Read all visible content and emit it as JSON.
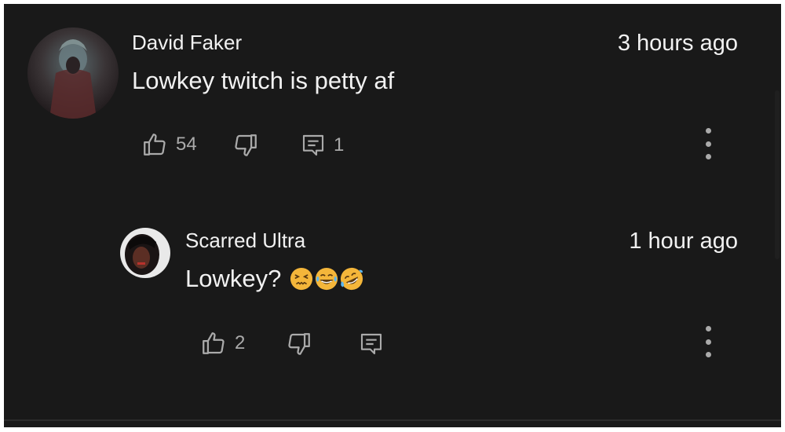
{
  "comments": [
    {
      "author": "David Faker",
      "timestamp": "3 hours ago",
      "text": "Lowkey twitch is petty af",
      "likes": "54",
      "replies": "1",
      "avatar_icon": "dark-character-avatar"
    }
  ],
  "replies": [
    {
      "author": "Scarred Ultra",
      "timestamp": "1 hour ago",
      "text": "Lowkey?",
      "emojis": [
        "confounded-face",
        "face-with-tears-of-joy",
        "rolling-on-floor-laughing"
      ],
      "likes": "2",
      "avatar_icon": "person-avatar"
    }
  ],
  "colors": {
    "background": "#191919",
    "text": "#f1f1f1",
    "secondary": "#aaaaaa",
    "emoji": "#f4b63a"
  }
}
